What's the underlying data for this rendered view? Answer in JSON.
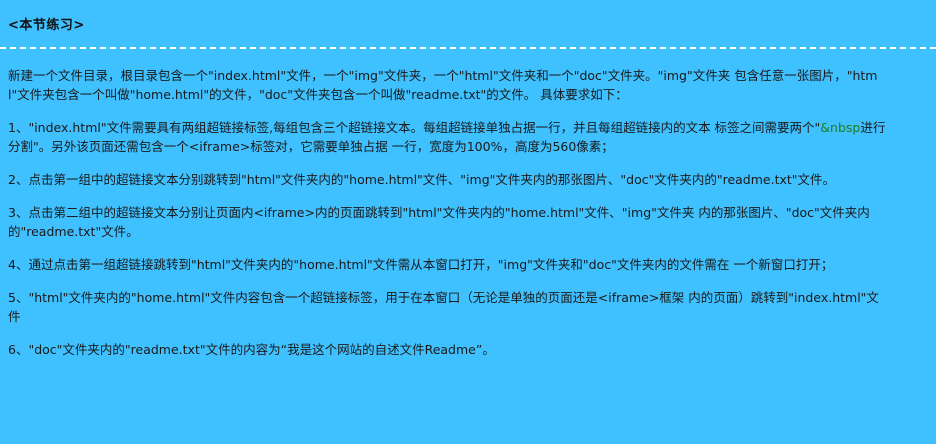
{
  "title": "<本节练习>",
  "intro": "新建一个文件目录，根目录包含一个\"index.html\"文件，一个\"img\"文件夹，一个\"html\"文件夹和一个\"doc\"文件夹。\"img\"文件夹 包含任意一张图片，\"html\"文件夹包含一个叫做\"home.html\"的文件，\"doc\"文件夹包含一个叫做\"readme.txt\"的文件。 具体要求如下：",
  "items": [
    {
      "pre": "1、\"index.html\"文件需要具有两组超链接标签,每组包含三个超链接文本。每组超链接单独占据一行，并且每组超链接内的文本 标签之间需要两个\"",
      "code": "&nbsp",
      "post": "进行分割\"。另外该页面还需包含一个<iframe>标签对，它需要单独占据 一行，宽度为100%，高度为560像素；"
    },
    {
      "text": "2、点击第一组中的超链接文本分别跳转到\"html\"文件夹内的\"home.html\"文件、\"img\"文件夹内的那张图片、\"doc\"文件夹内的\"readme.txt\"文件。"
    },
    {
      "text": "3、点击第二组中的超链接文本分别让页面内<iframe>内的页面跳转到\"html\"文件夹内的\"home.html\"文件、\"img\"文件夹 内的那张图片、\"doc\"文件夹内的\"readme.txt\"文件。"
    },
    {
      "text": "4、通过点击第一组超链接跳转到\"html\"文件夹内的\"home.html\"文件需从本窗口打开，\"img\"文件夹和\"doc\"文件夹内的文件需在 一个新窗口打开；"
    },
    {
      "text": "5、\"html\"文件夹内的\"home.html\"文件内容包含一个超链接标签，用于在本窗口（无论是单独的页面还是<iframe>框架 内的页面）跳转到\"index.html\"文件"
    },
    {
      "text": "6、\"doc\"文件夹内的\"readme.txt\"文件的内容为“我是这个网站的自述文件Readme”。"
    }
  ]
}
